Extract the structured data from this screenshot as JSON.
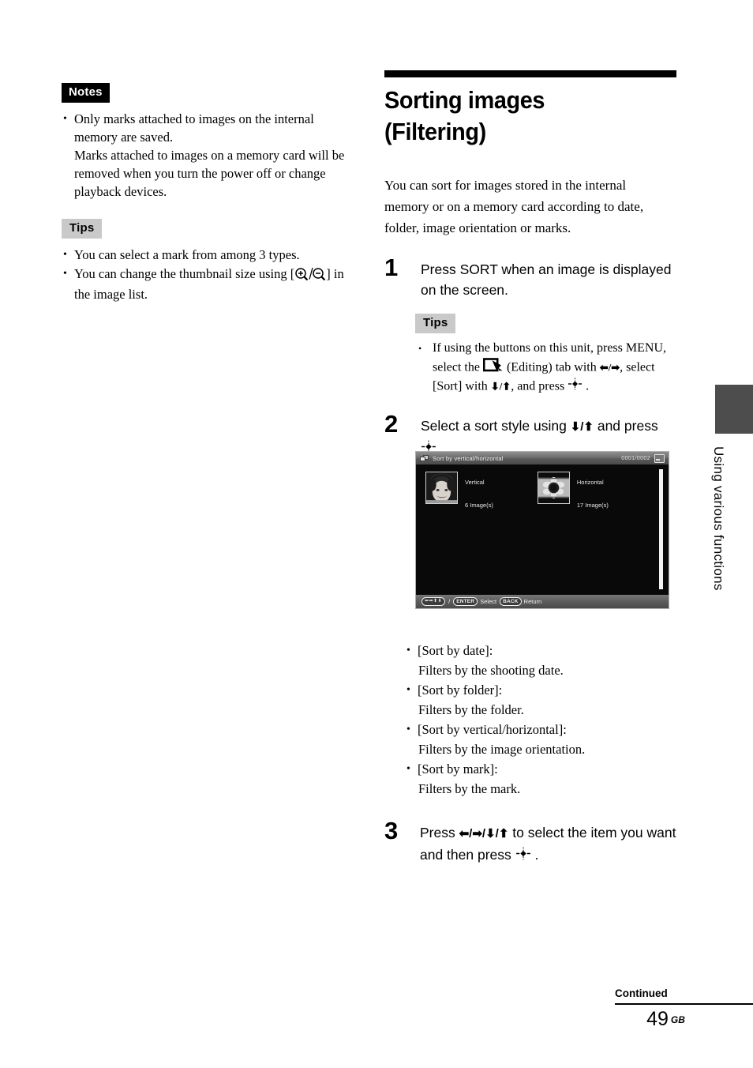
{
  "left_column": {
    "notes_badge": "Notes",
    "notes_items": [
      "Only marks attached to images on the internal memory are saved.\nMarks attached to images on a memory card will be removed when you turn the power off or change playback devices."
    ],
    "tips_badge": "Tips",
    "tips_item_1": "You can select a mark from among 3 types.",
    "tips_item_2_pre": "You can change the thumbnail size using [",
    "tips_item_2_post": "] in the image list."
  },
  "right_column": {
    "heading_line1": "Sorting images",
    "heading_line2": "(Filtering)",
    "intro": "You can sort for images stored in the internal memory or on a memory card according to date, folder, image orientation or marks.",
    "steps": [
      {
        "number": "1",
        "text": "Press SORT when an image is displayed on the screen."
      },
      {
        "number": "2",
        "text_pre": "Select a sort style using ",
        "text_arrows": "⬇/⬆",
        "text_mid": " and press ",
        "text_post": " ."
      },
      {
        "number": "3",
        "text_pre": "Press ",
        "text_arrows": "⬅/➡/⬇/⬆",
        "text_mid": " to select the item you want and then press ",
        "text_post": " ."
      }
    ],
    "inner_tips": {
      "badge": "Tips",
      "part1": "If using the buttons on this unit, press MENU, select the ",
      "icon_name": "editing-tab-icon",
      "part2": " (Editing) tab with ",
      "arrows1": "⬅/➡",
      "part3": ", select [Sort] with ",
      "arrows2": "⬇/⬆",
      "part4": ", and press ",
      "part5": " ."
    },
    "sort_options": [
      {
        "label": "[Sort by date]:",
        "desc": "Filters by the shooting date."
      },
      {
        "label": "[Sort by folder]:",
        "desc": "Filters by the folder."
      },
      {
        "label": "[Sort by vertical/horizontal]:",
        "desc": "Filters by the image orientation."
      },
      {
        "label": "[Sort by mark]:",
        "desc": "Filters by the mark."
      }
    ]
  },
  "device_screenshot": {
    "title": "Sort by vertical/horizontal",
    "counter": "0001/0002",
    "items": [
      {
        "label": "Vertical",
        "count": "6 Image(s)",
        "thumb": "portrait-child-thumbnail"
      },
      {
        "label": "Horizontal",
        "count": "17 Image(s)",
        "thumb": "sunflower-thumbnail"
      }
    ],
    "bottom_bar": {
      "arrows": "⬅➡⬆⬇",
      "separator": "/",
      "enter_key": "ENTER",
      "enter_action": "Select",
      "back_key": "BACK",
      "back_action": "Return"
    }
  },
  "side_tab": {
    "label": "Using various functions"
  },
  "footer": {
    "continued": "Continued",
    "page_number": "49",
    "page_suffix": "GB"
  },
  "colors": {
    "notes_badge_bg": "#000000",
    "tips_badge_bg": "#c9c9c9",
    "side_tab_bg": "#4d4d4d",
    "device_bg": "#090909"
  }
}
